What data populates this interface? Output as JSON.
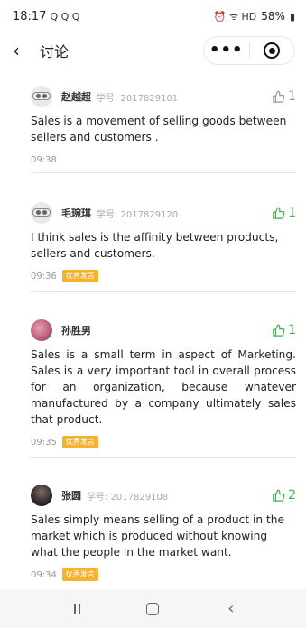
{
  "status_bar": {
    "time": "18:17",
    "left_icons": "Q Q Q",
    "right_icons": "⏰ ᯤ HD",
    "battery": "58%"
  },
  "nav": {
    "back_glyph": "‹",
    "title": "讨论",
    "more_glyph": "•••"
  },
  "comments": [
    {
      "avatar": "robot-avatar",
      "name": "赵越超",
      "id_label": "学号: 2017829101",
      "likes": "1",
      "liked": false,
      "text": "Sales is a movement of selling goods between sellers and customers .",
      "time": "09:38",
      "badge": ""
    },
    {
      "avatar": "robot-avatar",
      "name": "毛琬琪",
      "id_label": "学号: 2017829120",
      "likes": "1",
      "liked": true,
      "text": "I think sales is the affinity between products, sellers and customers.",
      "time": "09:36",
      "badge": "优秀发言"
    },
    {
      "avatar": "photo-avatar",
      "name": "孙胜男",
      "id_label": "",
      "likes": "1",
      "liked": true,
      "text": "Sales is a small term in aspect of Marketing. Sales is a very important tool in overall process for an organization, because whatever manufactured by a company ultimately sales that product.",
      "time": "09:35",
      "badge": "优秀发言"
    },
    {
      "avatar": "photo-avatar",
      "name": "张圆",
      "id_label": "学号: 2017829108",
      "likes": "2",
      "liked": true,
      "text": "Sales simply means selling of a product in the market which is produced without knowing what the people in the market want.",
      "time": "09:34",
      "badge": "优秀发言"
    }
  ],
  "colors": {
    "like_active": "#3db24a",
    "like_inactive": "#999999",
    "badge": "#f8b12c"
  }
}
